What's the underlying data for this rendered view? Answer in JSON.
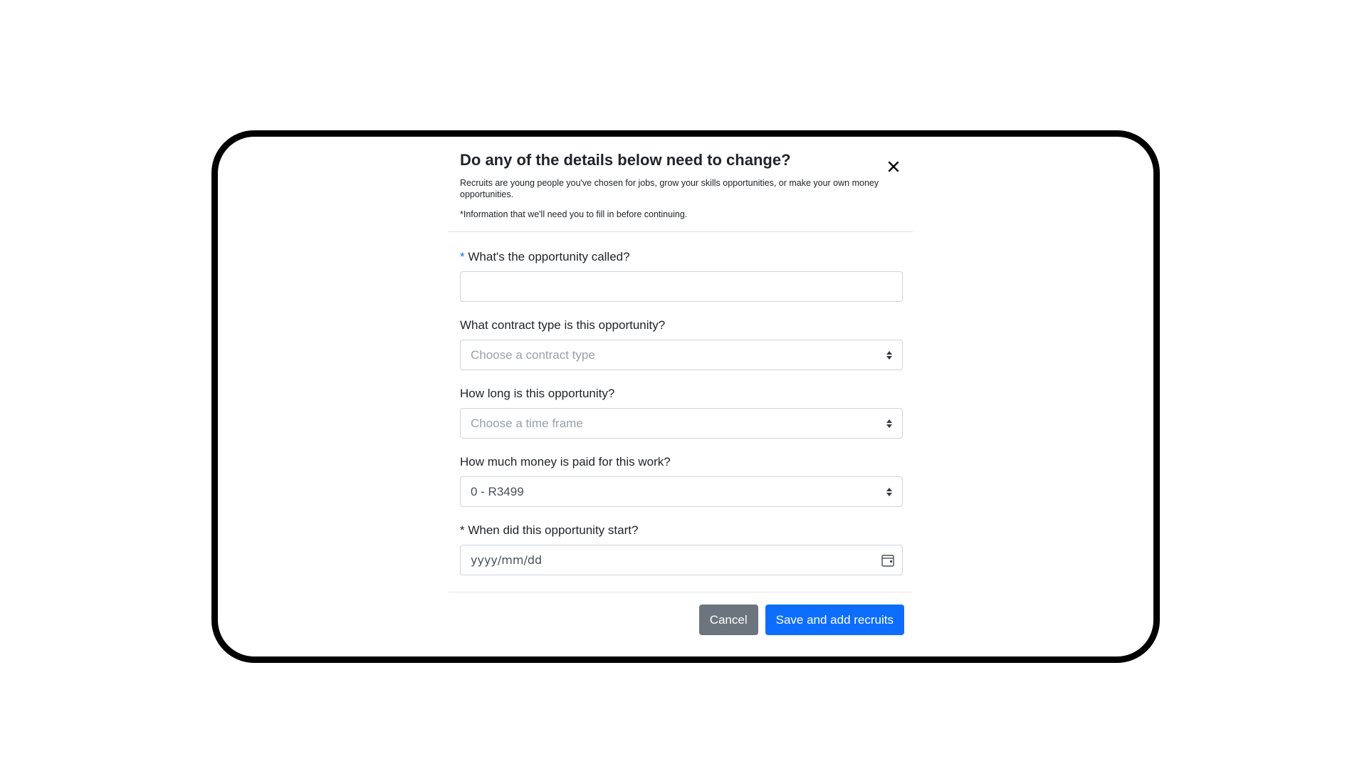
{
  "modal": {
    "title": "Do any of the details below need to change?",
    "subtitle": "Recruits are young people you've chosen for jobs, grow your skills opportunities, or make your own money opportunities.",
    "note": "*Information that we'll need you to fill in before continuing.",
    "close_icon": "close-icon"
  },
  "form": {
    "opportunity_name": {
      "required_marker": "*",
      "label": "What's the opportunity called?",
      "value": ""
    },
    "contract_type": {
      "label": "What contract type is this opportunity?",
      "placeholder": "Choose a contract type"
    },
    "duration": {
      "label": "How long is this opportunity?",
      "placeholder": "Choose a time frame"
    },
    "pay": {
      "label": "How much money is paid for this work?",
      "value": "0 - R3499"
    },
    "start_date": {
      "label": "* When did this opportunity start?",
      "placeholder": "yyyy/mm/dd"
    }
  },
  "footer": {
    "cancel_label": "Cancel",
    "save_label": "Save and add recruits"
  },
  "colors": {
    "primary": "#0d6efd",
    "secondary": "#6c757d",
    "frame": "#000000"
  }
}
